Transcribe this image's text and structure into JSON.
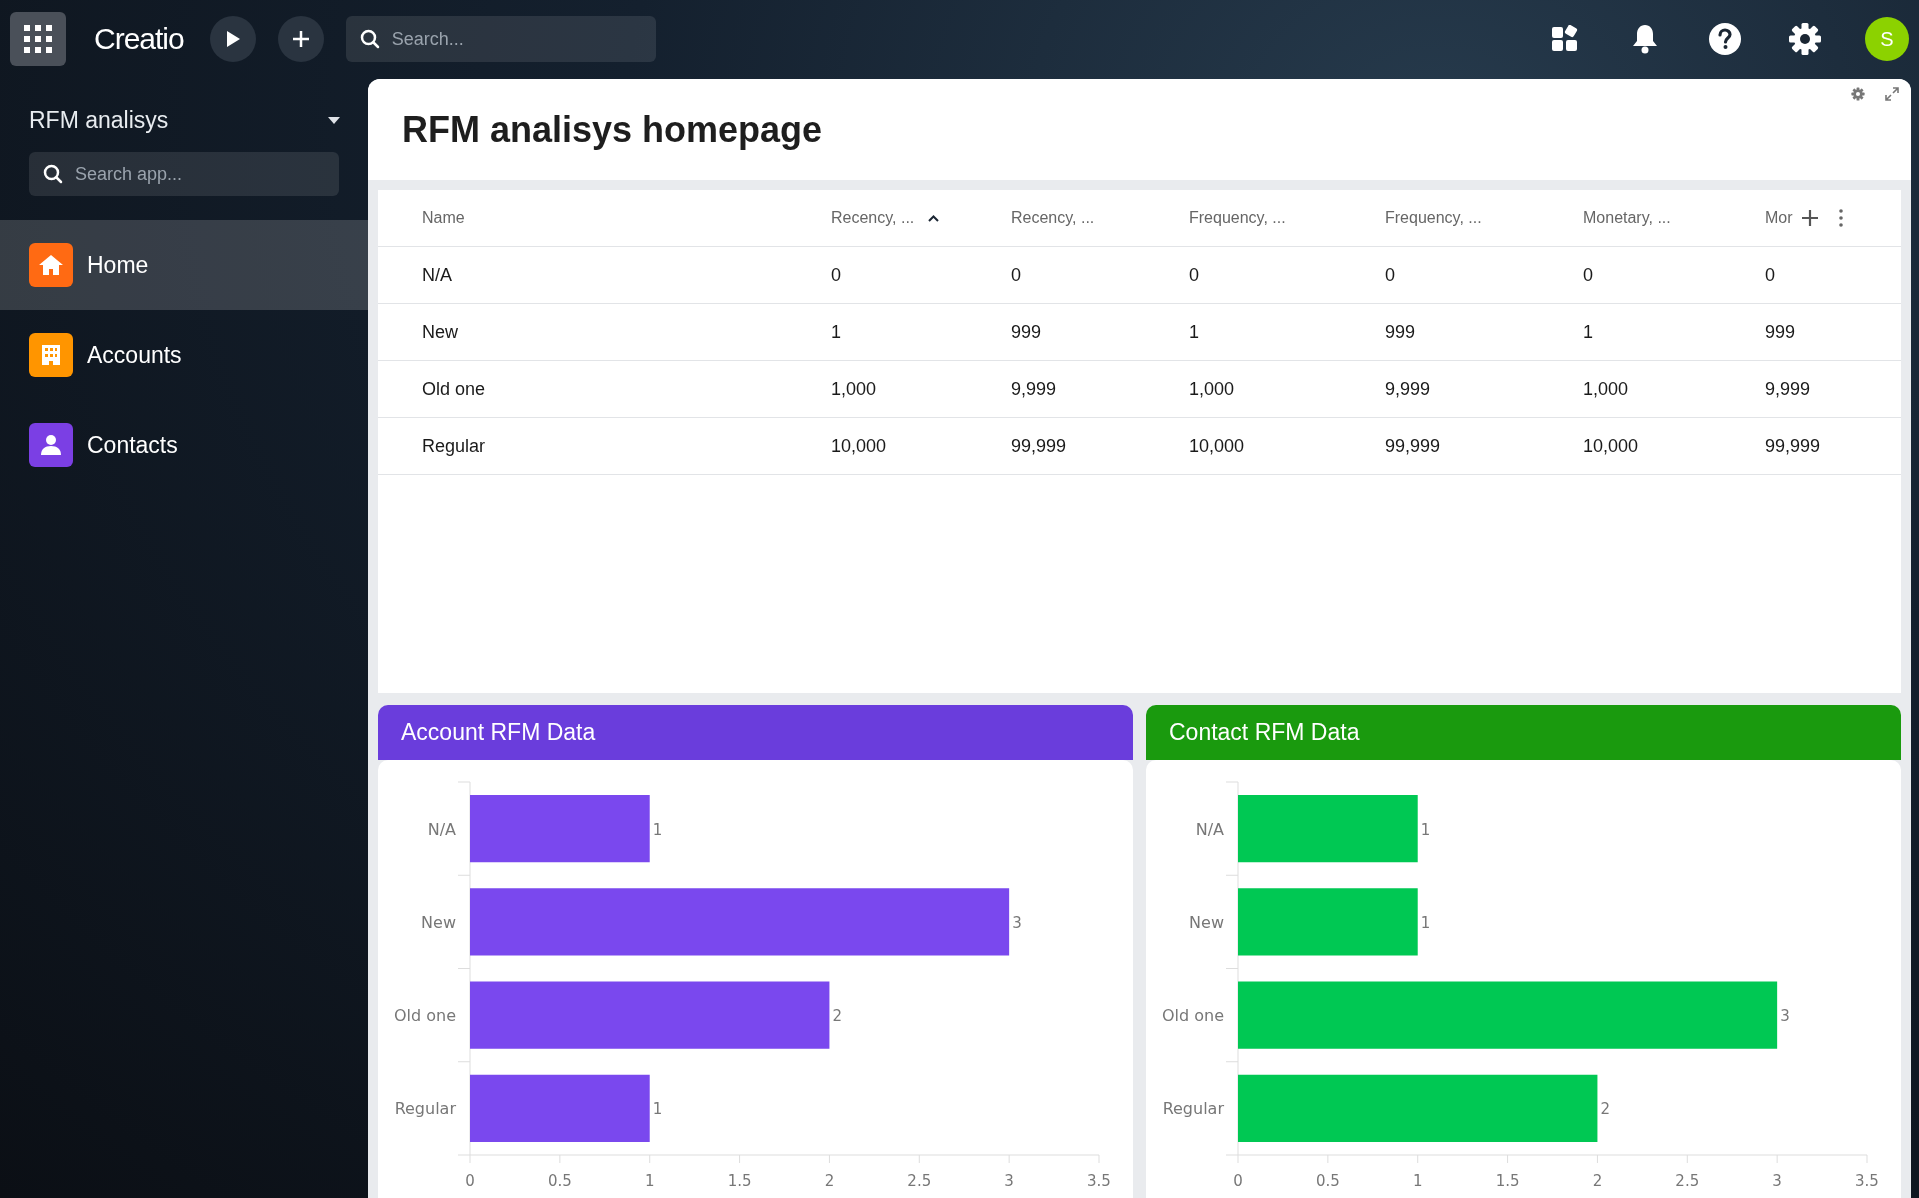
{
  "topbar": {
    "logo": "Creatio",
    "search": {
      "placeholder": "Search..."
    },
    "avatar": "S"
  },
  "sidebar": {
    "app_title": "RFM analisys",
    "search": {
      "placeholder": "Search app..."
    },
    "items": [
      {
        "label": "Home",
        "selected": true,
        "color": "#ff6a13"
      },
      {
        "label": "Accounts",
        "selected": false,
        "color": "#ff9500"
      },
      {
        "label": "Contacts",
        "selected": false,
        "color": "#7b3fe4"
      }
    ]
  },
  "page": {
    "title": "RFM analisys homepage"
  },
  "table": {
    "columns": [
      {
        "label": "Name",
        "sorted": false
      },
      {
        "label": "Recency, ...",
        "sorted": true
      },
      {
        "label": "Recency, ...",
        "sorted": false
      },
      {
        "label": "Frequency, ...",
        "sorted": false
      },
      {
        "label": "Frequency, ...",
        "sorted": false
      },
      {
        "label": "Monetary, ...",
        "sorted": false
      },
      {
        "label": "Mor",
        "sorted": false
      }
    ],
    "rows": [
      [
        "N/A",
        "0",
        "0",
        "0",
        "0",
        "0",
        "0"
      ],
      [
        "New",
        "1",
        "999",
        "1",
        "999",
        "1",
        "999"
      ],
      [
        "Old one",
        "1,000",
        "9,999",
        "1,000",
        "9,999",
        "1,000",
        "9,999"
      ],
      [
        "Regular",
        "10,000",
        "99,999",
        "10,000",
        "99,999",
        "10,000",
        "99,999"
      ]
    ]
  },
  "widgets": [
    {
      "title": "Account RFM Data",
      "color": "#6a3ddc",
      "chart_data": {
        "type": "bar",
        "orientation": "horizontal",
        "categories": [
          "N/A",
          "New",
          "Old one",
          "Regular"
        ],
        "series": [
          {
            "color": "#7a48ee",
            "values": [
              1,
              3,
              2,
              1
            ]
          }
        ],
        "xlim": [
          0,
          3.5
        ],
        "xticks": [
          0,
          0.5,
          1,
          1.5,
          2,
          2.5,
          3,
          3.5
        ],
        "data_labels": true
      }
    },
    {
      "title": "Contact RFM Data",
      "color": "#1a9a0e",
      "chart_data": {
        "type": "bar",
        "orientation": "horizontal",
        "categories": [
          "N/A",
          "New",
          "Old one",
          "Regular"
        ],
        "series": [
          {
            "color": "#00c853",
            "values": [
              1,
              1,
              3,
              2
            ]
          }
        ],
        "xlim": [
          0,
          3.5
        ],
        "xticks": [
          0,
          0.5,
          1,
          1.5,
          2,
          2.5,
          3,
          3.5
        ],
        "data_labels": true
      }
    }
  ]
}
